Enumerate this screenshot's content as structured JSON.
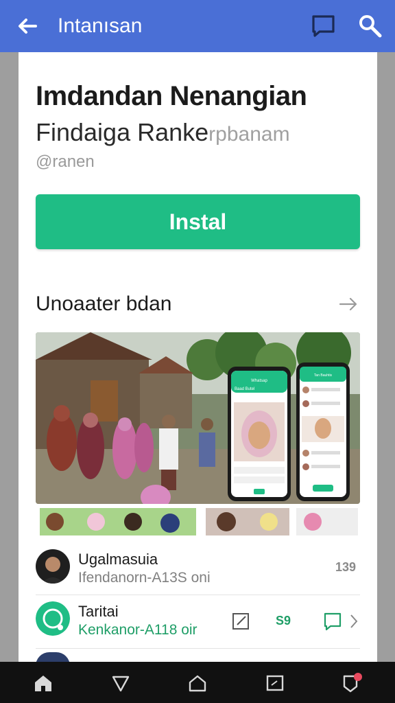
{
  "appbar": {
    "title": "Intanısan",
    "icons": [
      "back-arrow-icon",
      "square-chat-icon",
      "search-icon"
    ]
  },
  "app": {
    "name": "Imdandan Nenangian",
    "subtitle_main": "Findaiga Ranke",
    "subtitle_faded": "rpbanam",
    "developer": "@ranen"
  },
  "install_label": "Instal",
  "section": {
    "title": "Unoaater bdan",
    "arrow_icon": "arrow-right-icon"
  },
  "screenshot": {
    "phone_left_header": "Whatsap",
    "phone_left_title": "Baad Butel",
    "phone_right_title": "Tan Bauhtis"
  },
  "list": [
    {
      "name": "Ugalmasuia",
      "sub": "Ifendanorn-A13S oni",
      "meta": "139"
    },
    {
      "name": "Taritai",
      "sub": "Kenkanor-A118 oir",
      "meta": "S9"
    }
  ],
  "colors": {
    "appbar": "#4a6fd6",
    "install": "#1fbd85",
    "accent_green": "#1f9e67"
  },
  "navbar_icons": [
    "home-icon",
    "shield-down-icon",
    "house-outline-icon",
    "window-icon",
    "badge-notification-icon"
  ]
}
